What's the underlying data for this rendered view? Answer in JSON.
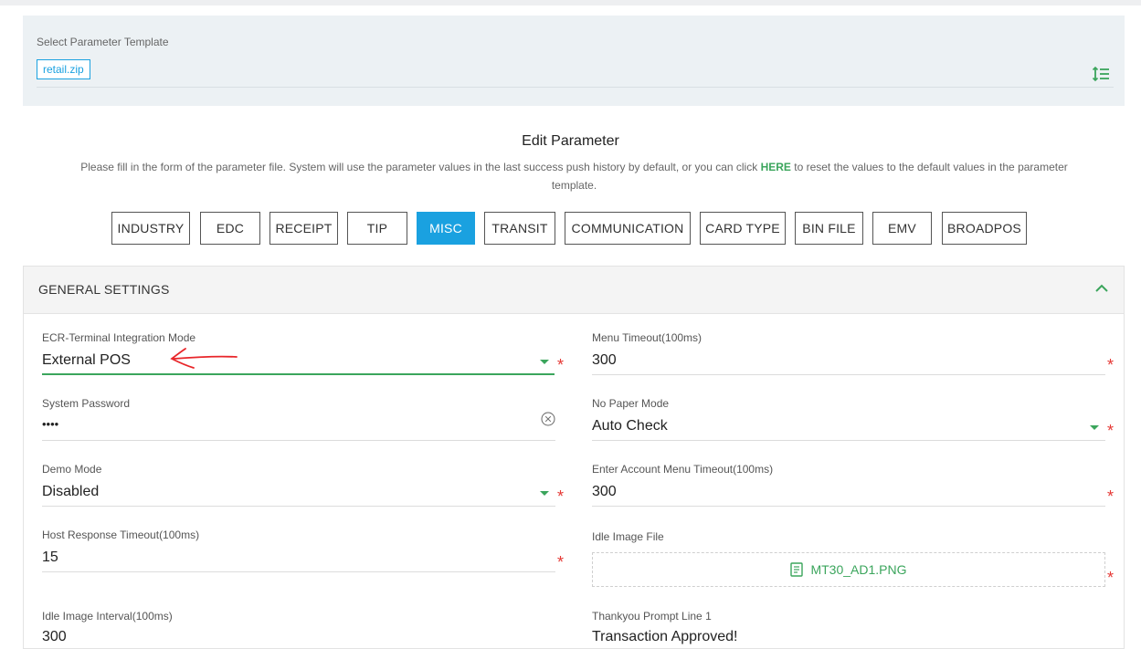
{
  "template": {
    "label": "Select Parameter Template",
    "selected": "retail.zip",
    "icon": "sort-list-icon"
  },
  "edit": {
    "title": "Edit Parameter",
    "desc_before": "Please fill in the form of the parameter file. System will use the parameter values in the last success push history by default, or you can click ",
    "desc_link": "HERE",
    "desc_after": " to reset the values to the default values in the parameter template."
  },
  "tabs": [
    "INDUSTRY",
    "EDC",
    "RECEIPT",
    "TIP",
    "MISC",
    "TRANSIT",
    "COMMUNICATION",
    "CARD TYPE",
    "BIN FILE",
    "EMV",
    "BROADPOS"
  ],
  "active_tab": "MISC",
  "section": {
    "title": "GENERAL SETTINGS"
  },
  "fields": {
    "ecr_mode": {
      "label": "ECR-Terminal Integration Mode",
      "value": "External POS"
    },
    "menu_timeout": {
      "label": "Menu Timeout(100ms)",
      "value": "300"
    },
    "system_password": {
      "label": "System Password",
      "value": "••••"
    },
    "no_paper_mode": {
      "label": "No Paper Mode",
      "value": "Auto Check"
    },
    "demo_mode": {
      "label": "Demo Mode",
      "value": "Disabled"
    },
    "enter_account_timeout": {
      "label": "Enter Account Menu Timeout(100ms)",
      "value": "300"
    },
    "host_response_timeout": {
      "label": "Host Response Timeout(100ms)",
      "value": "15"
    },
    "idle_image_file": {
      "label": "Idle Image File",
      "value": "MT30_AD1.PNG"
    },
    "idle_image_interval": {
      "label": "Idle Image Interval(100ms)",
      "value": "300"
    },
    "thankyou_prompt_line1": {
      "label": "Thankyou Prompt Line 1",
      "value": "Transaction Approved!"
    }
  },
  "required_mark": "*",
  "colors": {
    "accent_blue": "#1aa1e0",
    "accent_green": "#3ba55c",
    "required_red": "#e53935",
    "annotation_red": "#e8262a"
  }
}
